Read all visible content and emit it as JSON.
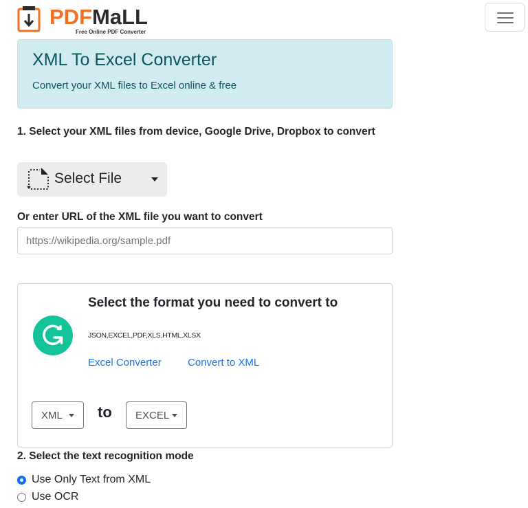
{
  "header": {
    "logo_pdf": "PDF",
    "logo_mall": "MaLL",
    "logo_tagline": "Free Online PDF Converter",
    "menu_icon": "hamburger-menu-icon"
  },
  "banner": {
    "title": "XML To Excel Converter",
    "subtitle": "Convert your XML files to Excel online & free"
  },
  "step1": {
    "label": "1. Select your XML files from device, Google Drive, Dropbox to convert",
    "select_file_label": "Select File",
    "select_file_icon": "file-select-icon"
  },
  "url": {
    "label": "Or enter URL of the XML file you want to convert",
    "placeholder": "https://wikipedia.org/sample.pdf",
    "value": ""
  },
  "format_card": {
    "icon": "grammarly-g-icon",
    "title": "Select the format you need to convert to",
    "formats": "JSON,EXCEL,PDF,XLS,HTML,XLSX",
    "links": [
      "Excel Converter",
      "Convert to XML"
    ],
    "from_value": "XML",
    "to_label": "to",
    "to_value": "EXCEL"
  },
  "step2": {
    "label": "2. Select the text recognition mode",
    "options": [
      {
        "label": "Use Only Text from XML",
        "checked": true
      },
      {
        "label": "Use OCR",
        "checked": false
      }
    ]
  },
  "colors": {
    "brand_orange": "#f36f21",
    "banner_bg": "#d1ecf1",
    "banner_text": "#0c5460",
    "link_blue": "#1a73e8",
    "grammarly_green": "#15c39a",
    "radio_blue": "#0d6efd"
  }
}
